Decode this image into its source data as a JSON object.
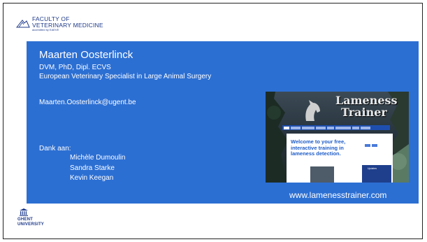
{
  "faculty_logo": {
    "line1": "FACULTY OF",
    "line2": "VETERINARY MEDICINE",
    "accreditation": "accredited by EAEVE"
  },
  "presenter": {
    "name": "Maarten Oosterlinck",
    "credentials": "DVM, PhD, Dipl. ECVS",
    "title": "European Veterinary Specialist in Large Animal Surgery",
    "email": "Maarten.Oosterlinck@ugent.be"
  },
  "thanks": {
    "heading": "Dank aan:",
    "names": [
      "Michèle Dumoulin",
      "Sandra Starke",
      "Kevin Keegan"
    ]
  },
  "website_preview": {
    "title_line1": "Lameness",
    "title_line2": "Trainer",
    "welcome": "Welcome to your free, interactive training in lameness detection.",
    "panel_label": "Updates"
  },
  "url": "www.lamenesstrainer.com",
  "ghent_logo": {
    "line1": "GHENT",
    "line2": "UNIVERSITY"
  },
  "colors": {
    "band": "#2c6fd3",
    "logo_blue": "#1e3a8a",
    "text": "#ffffff"
  }
}
